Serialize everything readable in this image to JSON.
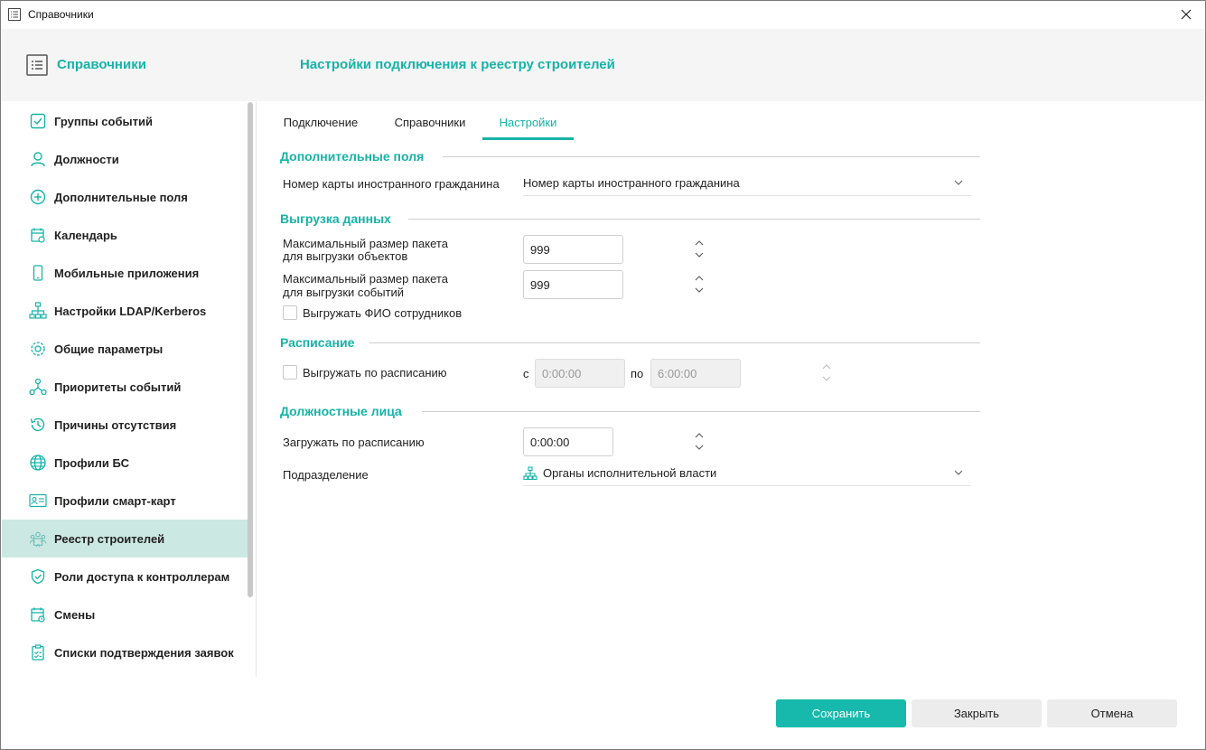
{
  "window": {
    "title": "Справочники"
  },
  "header": {
    "brand": "Справочники",
    "page_title": "Настройки подключения к реестру строителей"
  },
  "colors": {
    "accent": "#16b3a7",
    "active_bg": "#cce8e3",
    "primary_button": "#16b9ab"
  },
  "sidebar": {
    "items": [
      {
        "label": "Группы событий",
        "icon": "checkbox-icon"
      },
      {
        "label": "Должности",
        "icon": "user-icon"
      },
      {
        "label": "Дополнительные поля",
        "icon": "plus-circle-icon"
      },
      {
        "label": "Календарь",
        "icon": "calendar-icon"
      },
      {
        "label": "Мобильные приложения",
        "icon": "phone-icon"
      },
      {
        "label": "Настройки LDAP/Kerberos",
        "icon": "network-icon"
      },
      {
        "label": "Общие параметры",
        "icon": "gear-icon"
      },
      {
        "label": "Приоритеты событий",
        "icon": "nodes-icon"
      },
      {
        "label": "Причины отсутствия",
        "icon": "history-icon"
      },
      {
        "label": "Профили БС",
        "icon": "globe-icon"
      },
      {
        "label": "Профили смарт-карт",
        "icon": "id-card-icon"
      },
      {
        "label": "Реестр строителей",
        "icon": "builders-icon",
        "active": true
      },
      {
        "label": "Роли доступа к контроллерам",
        "icon": "shield-check-icon"
      },
      {
        "label": "Смены",
        "icon": "calendar-clock-icon"
      },
      {
        "label": "Списки подтверждения заявок",
        "icon": "clipboard-icon"
      }
    ]
  },
  "tabs": [
    {
      "label": "Подключение"
    },
    {
      "label": "Справочники"
    },
    {
      "label": "Настройки",
      "active": true
    }
  ],
  "sections": {
    "extra_fields": {
      "title": "Дополнительные поля",
      "foreign_card_label": "Номер карты иностранного гражданина",
      "foreign_card_value": "Номер карты иностранного гражданина"
    },
    "export": {
      "title": "Выгрузка данных",
      "objects_label_1": "Максимальный размер пакета",
      "objects_label_2": "для выгрузки объектов",
      "objects_value": "999",
      "events_label_1": "Максимальный размер пакета",
      "events_label_2": "для выгрузки событий",
      "events_value": "999",
      "export_names_label": "Выгружать ФИО сотрудников",
      "export_names_checked": false
    },
    "schedule": {
      "title": "Расписание",
      "scheduled_label": "Выгружать по расписанию",
      "scheduled_checked": false,
      "from_label": "с",
      "from_value": "0:00:00",
      "to_label": "по",
      "to_value": "6:00:00"
    },
    "officials": {
      "title": "Должностные лица",
      "load_label": "Загружать по расписанию",
      "load_value": "0:00:00",
      "division_label": "Подразделение",
      "division_value": "Органы исполнительной власти"
    }
  },
  "footer": {
    "save": "Сохранить",
    "close": "Закрыть",
    "cancel": "Отмена"
  }
}
